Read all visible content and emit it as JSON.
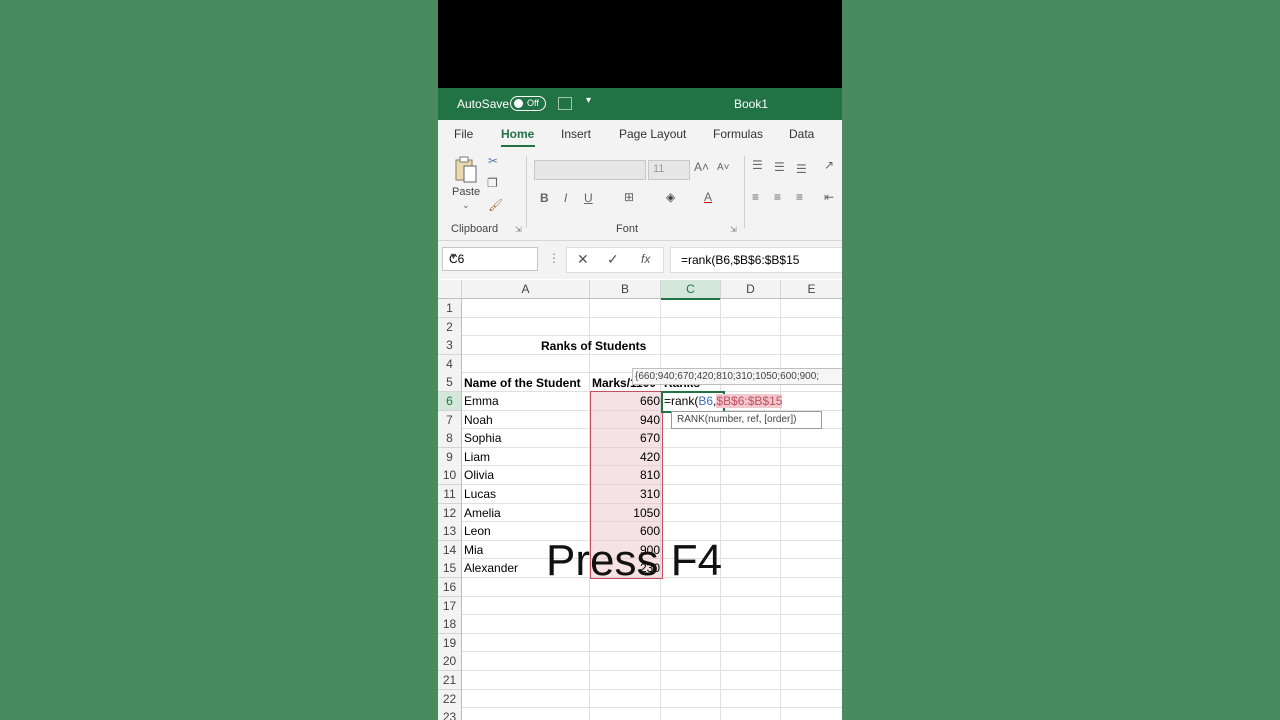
{
  "title_bar": {
    "autosave_label": "AutoSave",
    "toggle_state": "Off",
    "workbook_title": "Book1"
  },
  "ribbon": {
    "tabs": [
      "File",
      "Home",
      "Insert",
      "Page Layout",
      "Formulas",
      "Data"
    ],
    "active_tab": "Home",
    "paste_label": "Paste",
    "groups": [
      "Clipboard",
      "Font"
    ],
    "font_size": "11"
  },
  "formula_bar": {
    "name_box": "C6",
    "formula": "=rank(B6,$B$6:$B$15"
  },
  "grid": {
    "columns": [
      "A",
      "B",
      "C",
      "D",
      "E"
    ],
    "rows": [
      "1",
      "2",
      "3",
      "4",
      "5",
      "6",
      "7",
      "8",
      "9",
      "10",
      "11",
      "12",
      "13",
      "14",
      "15",
      "16",
      "17",
      "18",
      "19",
      "20",
      "21",
      "22",
      "23"
    ],
    "title": "Ranks of Students",
    "headers": {
      "name": "Name of the Student",
      "marks": "Marks/1100",
      "ranks": "Ranks"
    },
    "students": [
      {
        "name": "Emma",
        "marks": "660"
      },
      {
        "name": "Noah",
        "marks": "940"
      },
      {
        "name": "Sophia",
        "marks": "670"
      },
      {
        "name": "Liam",
        "marks": "420"
      },
      {
        "name": "Olivia",
        "marks": "810"
      },
      {
        "name": "Lucas",
        "marks": "310"
      },
      {
        "name": "Amelia",
        "marks": "1050"
      },
      {
        "name": "Leon",
        "marks": "600"
      },
      {
        "name": "Mia",
        "marks": "900"
      },
      {
        "name": "Alexander",
        "marks": "230"
      }
    ],
    "edit_cell": {
      "prefix": "=rank(",
      "arg1": "B6",
      "comma": ",",
      "arg2": "$B$6:$B$15"
    },
    "syntax_tooltip": "RANK(number, ref, [order])",
    "eval_tooltip": "{660;940;670;420;810;310;1050;600;900;"
  },
  "overlay_caption": "Press F4",
  "colors": {
    "excel_green": "#217346",
    "background": "#4a8a5f",
    "ref_highlight": "#c0505e",
    "arg1_blue": "#3a6fc4"
  }
}
